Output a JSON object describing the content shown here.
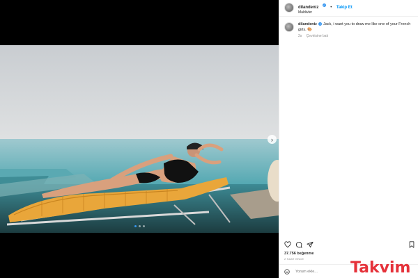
{
  "post": {
    "username": "dilandeniz",
    "follow_label": "Takip Et",
    "separator": "•",
    "location": "Maldivler"
  },
  "caption": {
    "username": "dilandeniz",
    "text": "Jack, i want you to draw me like one of your French girls. 🎨",
    "time": "2s",
    "translate_label": "Çevirisine bak"
  },
  "media": {
    "slide_count": 3,
    "active_slide": 1,
    "next_icon": "chevron-right-icon"
  },
  "engagement": {
    "likes": "37.756 beğenme",
    "posted_ago": "2 SAAT ÖNCE"
  },
  "comment": {
    "placeholder": "Yorum ekle..."
  },
  "watermark": {
    "text": "Takvim",
    "color": "#e5323a"
  },
  "colors": {
    "accent": "#0095f6",
    "verified": "#3897f0"
  }
}
